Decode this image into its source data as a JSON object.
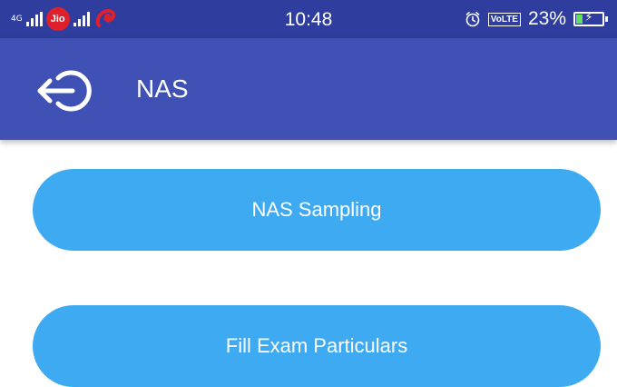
{
  "status_bar": {
    "network_type": "4G",
    "carrier_badge": "Jio",
    "time": "10:48",
    "volte_label": "VoLTE",
    "battery_percent": "23%",
    "battery_level": 0.23,
    "icons": [
      "signal-icon",
      "jio-icon",
      "airtel-icon",
      "alarm-icon",
      "battery-charging-icon"
    ]
  },
  "app_bar": {
    "title": "NAS",
    "back_icon": "logout-arrow-icon"
  },
  "actions": [
    {
      "label": "NAS Sampling"
    },
    {
      "label": "Fill Exam Particulars"
    }
  ],
  "colors": {
    "status_bar": "#2f3d9e",
    "app_bar": "#3f51b5",
    "button": "#3daaf2",
    "background": "#ffffff"
  }
}
